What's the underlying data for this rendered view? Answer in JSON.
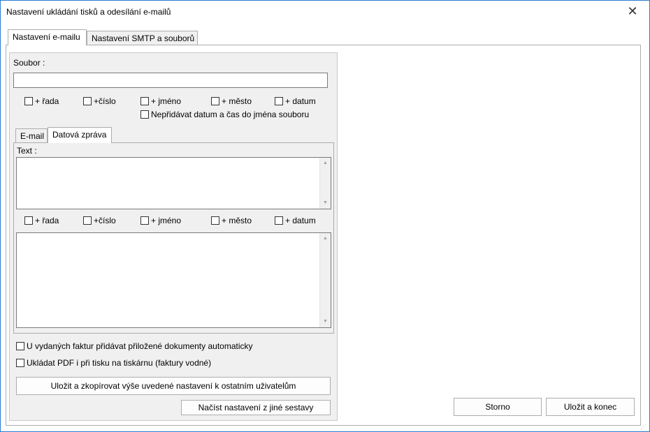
{
  "window": {
    "title": "Nastavení ukládání tisků a odesílání e-mailů",
    "close_glyph": "✕"
  },
  "tabs": [
    {
      "label": "Nastavení e-mailu",
      "active": true
    },
    {
      "label": "Nastavení SMTP a souborů",
      "active": false
    }
  ],
  "file": {
    "label": "Soubor :",
    "value": "",
    "options": [
      "+ řada",
      "+číslo",
      "+ jméno",
      "+ město",
      "+ datum"
    ],
    "no_datetime": "Nepřidávat datum a čas do jména souboru"
  },
  "subtabs": [
    {
      "label": "E-mail",
      "active": false
    },
    {
      "label": "Datová zpráva",
      "active": true
    }
  ],
  "message": {
    "text_label": "Text :",
    "text_value": "",
    "options": [
      "+ řada",
      "+číslo",
      "+ jméno",
      "+ město",
      "+ datum"
    ],
    "body_value": ""
  },
  "checks": {
    "attach_docs": "U vydaných faktur přidávat přiložené dokumenty automaticky",
    "save_pdf": "Ukládat PDF i při tisku na tiskárnu (faktury vodné)"
  },
  "buttons": {
    "save_copy": "Uložit a zkopírovat výše uvedené nastavení k ostatním uživatelům",
    "load": "Načíst nastavení z jiné sestavy",
    "cancel": "Storno",
    "save_close": "Uložit a konec"
  },
  "colors": {
    "accent_border": "#2b7bd0",
    "group_bg": "#f0f0f0"
  }
}
